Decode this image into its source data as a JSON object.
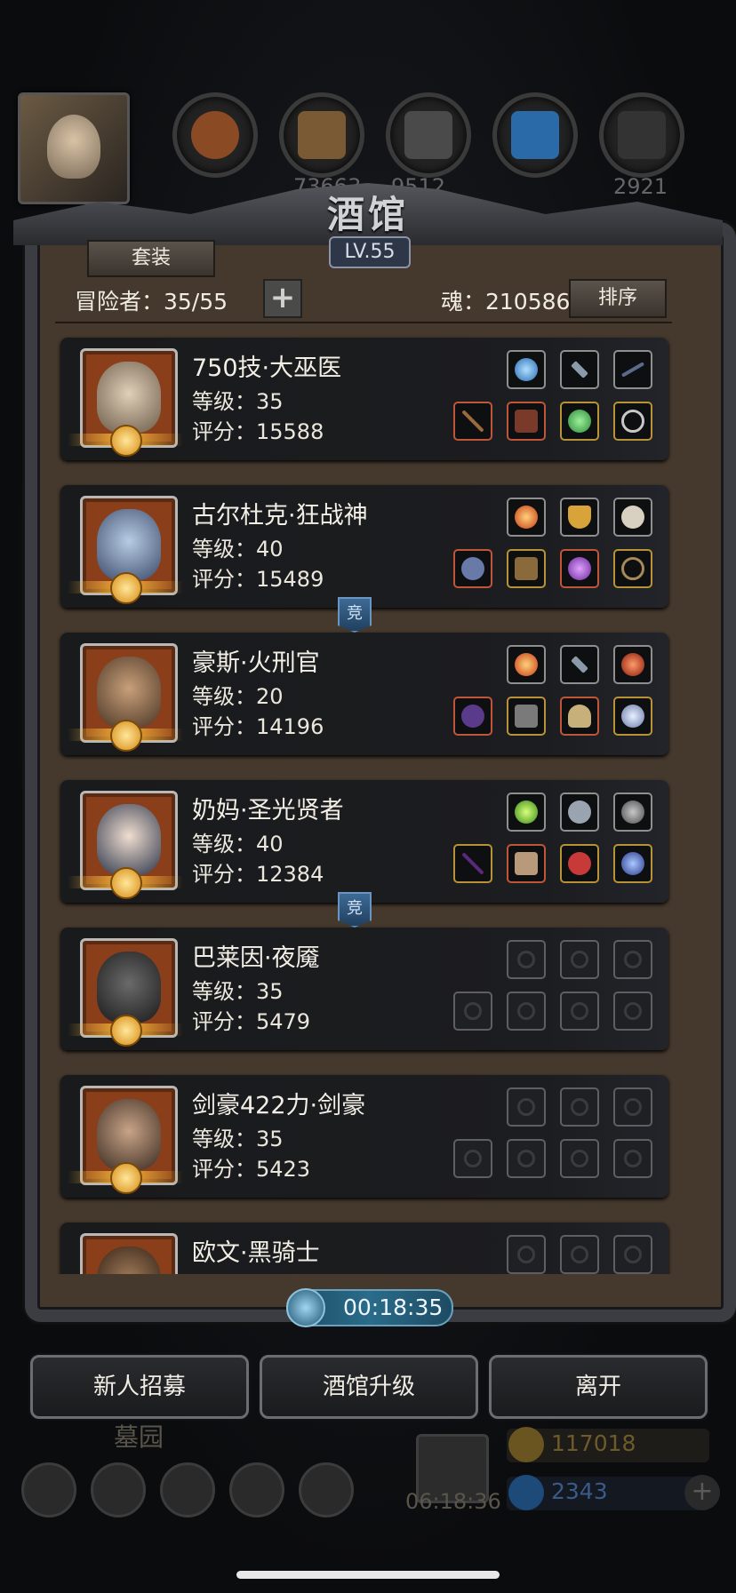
{
  "top": {
    "resources": [
      "",
      "73663",
      "9512",
      "",
      "2921"
    ]
  },
  "tavern": {
    "title": "酒馆",
    "level": "LV.55",
    "set_button": "套装",
    "adventurers_label": "冒险者：35/55",
    "plus_label": "+",
    "soul_label": "魂：210586",
    "sort_button": "排序"
  },
  "heroes": [
    {
      "name": "750技·大巫医",
      "level": "等级：35",
      "score": "评分：15588",
      "portrait_color": "#c8b49a"
    },
    {
      "name": "古尔杜克·狂战神",
      "level": "等级：40",
      "score": "评分：15489",
      "portrait_color": "#8aa4c4"
    },
    {
      "name": "豪斯·火刑官",
      "level": "等级：20",
      "score": "评分：14196",
      "portrait_color": "#9a7a58"
    },
    {
      "name": "奶妈·圣光贤者",
      "level": "等级：40",
      "score": "评分：12384",
      "portrait_color": "#d8c2b2"
    },
    {
      "name": "巴莱因·夜魇",
      "level": "等级：35",
      "score": "评分：5479",
      "portrait_color": "#3d3f45"
    },
    {
      "name": "剑豪422力·剑豪",
      "level": "等级：35",
      "score": "评分：5423",
      "portrait_color": "#a08268"
    },
    {
      "name": "欧文·黑骑士",
      "level": "",
      "score": "",
      "portrait_color": "#6a4a32"
    }
  ],
  "badges": {
    "jing": "竞"
  },
  "timer": "00:18:35",
  "buttons": {
    "recruit": "新人招募",
    "upgrade": "酒馆升级",
    "leave": "离开"
  },
  "bottom": {
    "graveyard": "墓园",
    "gift_timer": "06:18:36",
    "gold": "117018",
    "diamond": "2343",
    "add": "+"
  }
}
